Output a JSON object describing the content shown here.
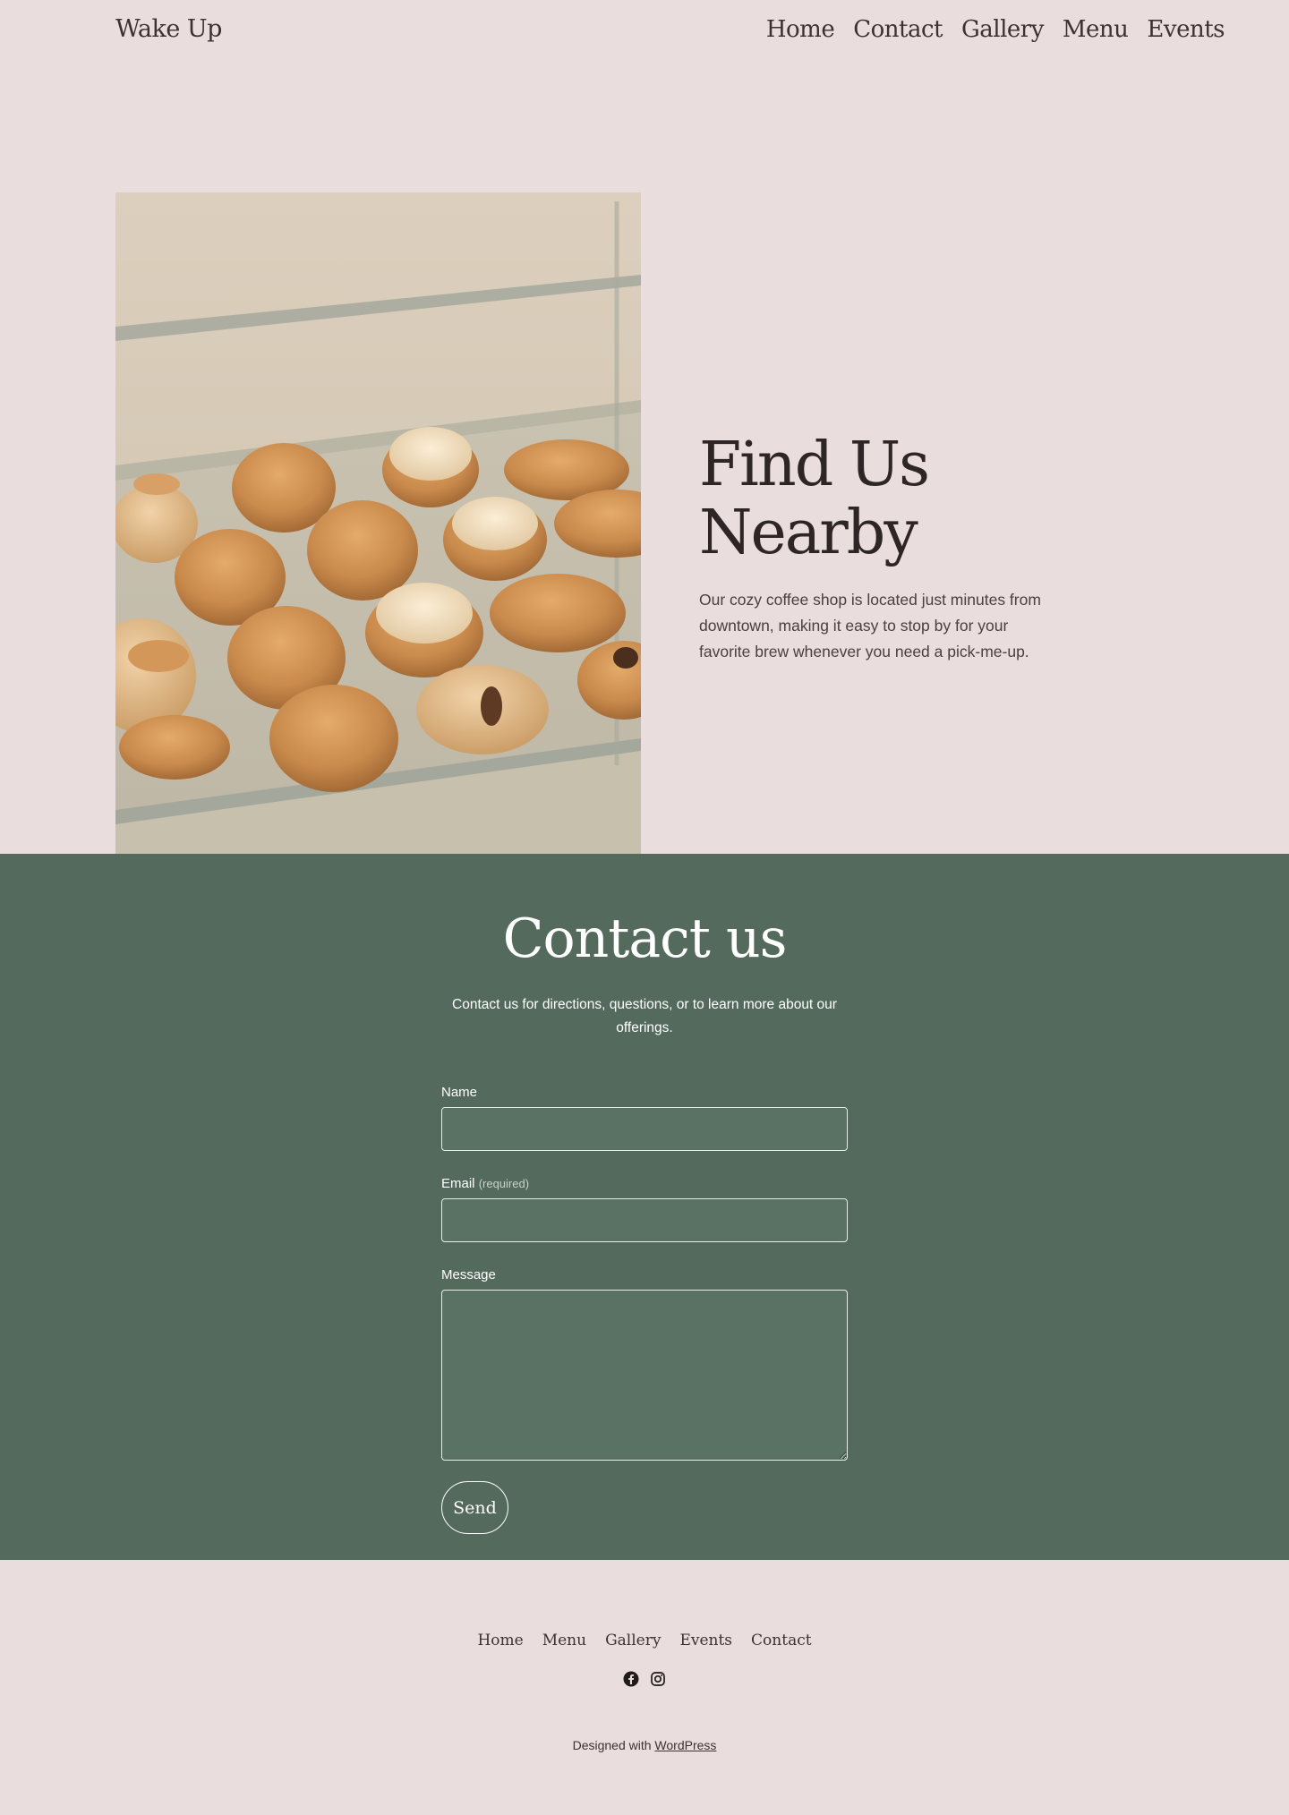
{
  "header": {
    "brand": "Wake Up",
    "nav": [
      "Home",
      "Contact",
      "Gallery",
      "Menu",
      "Events"
    ]
  },
  "hero": {
    "title_line1": "Find Us",
    "title_line2": "Nearby",
    "body": "Our cozy coffee shop is located just minutes from downtown, making it easy to stop by for your favorite brew whenever you need a pick-me-up."
  },
  "contact": {
    "title": "Contact us",
    "subtitle": "Contact us for directions, questions, or to learn more about our offerings.",
    "name_label": "Name",
    "email_label": "Email",
    "email_required": "(required)",
    "message_label": "Message",
    "name_value": "",
    "email_value": "",
    "message_value": "",
    "send_label": "Send"
  },
  "footer": {
    "nav": [
      "Home",
      "Menu",
      "Gallery",
      "Events",
      "Contact"
    ],
    "social": [
      "facebook-icon",
      "instagram-icon"
    ],
    "credit_prefix": "Designed with ",
    "credit_link": "WordPress"
  },
  "colors": {
    "page_bg": "#eaddde",
    "contact_bg": "#546a5d",
    "text": "#3b3333"
  }
}
